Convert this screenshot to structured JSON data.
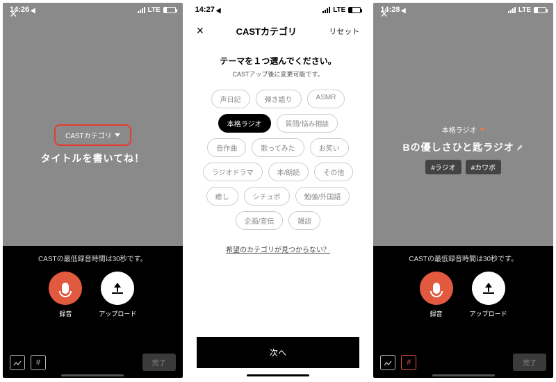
{
  "screen1": {
    "status": {
      "time": "14:26",
      "network": "LTE"
    },
    "category_label": "CASTカテゴリ",
    "title_placeholder": "タイトルを書いてね！",
    "min_rec_text": "CASTの最低録音時間は30秒です。",
    "record_label": "録音",
    "upload_label": "アップロード",
    "done_label": "完了"
  },
  "screen2": {
    "status": {
      "time": "14:27",
      "network": "LTE"
    },
    "header_title": "CASTカテゴリ",
    "reset_label": "リセット",
    "subtitle": "テーマを１つ選んでください。",
    "subnote": "CASTアップ後に変更可能です。",
    "categories": [
      "声日記",
      "弾き語り",
      "ASMR",
      "本格ラジオ",
      "質問/悩み相談",
      "自作曲",
      "歌ってみた",
      "お笑い",
      "ラジオドラマ",
      "本/朗読",
      "その他",
      "癒し",
      "シチュボ",
      "勉強/外国語",
      "企画/宣伝",
      "雑談"
    ],
    "selected_index": 3,
    "missing_link": "希望のカテゴリが見つからない？",
    "next_label": "次へ"
  },
  "screen3": {
    "status": {
      "time": "14:28",
      "network": "LTE"
    },
    "category_label": "本格ラジオ",
    "title_text": "Bの優しさひと匙ラジオ",
    "tags": [
      "#ラジオ",
      "#カワボ"
    ],
    "min_rec_text": "CASTの最低録音時間は30秒です。",
    "record_label": "録音",
    "upload_label": "アップロード",
    "done_label": "完了"
  }
}
